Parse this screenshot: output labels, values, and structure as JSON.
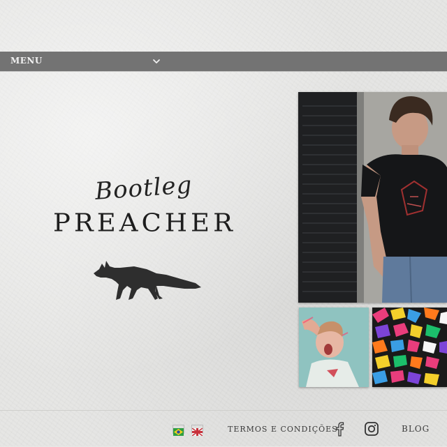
{
  "nav": {
    "menu_label": "MENU"
  },
  "brand": {
    "name_small": "Bootleg",
    "name_big": "PREACHER"
  },
  "footer": {
    "terms_label": "TERMOS E CONDIÇÕES",
    "blog_label": "BLOG"
  },
  "icons": {
    "menu_toggle": "chevron-down-icon",
    "language_pt": "brazil-flag-icon",
    "language_en": "uk-flag-icon",
    "facebook": "facebook-icon",
    "instagram": "instagram-icon",
    "logo_mark": "fox-icon"
  },
  "colors": {
    "menu_bar": "#737373",
    "text_dark": "#222222",
    "paper": "#e6e6e4"
  }
}
